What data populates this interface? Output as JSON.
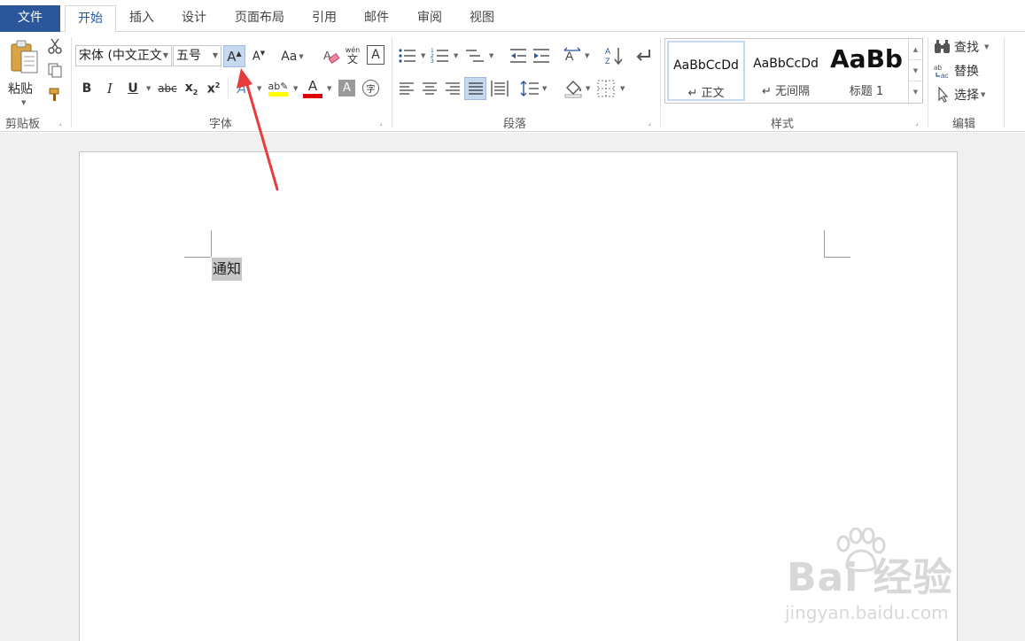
{
  "tabs": {
    "file": "文件",
    "home": "开始",
    "insert": "插入",
    "design": "设计",
    "layout": "页面布局",
    "references": "引用",
    "mailings": "邮件",
    "review": "审阅",
    "view": "视图"
  },
  "clipboard": {
    "paste_label": "粘贴",
    "group_label": "剪贴板"
  },
  "font": {
    "font_name": "宋体 (中文正文",
    "font_size": "五号",
    "change_case_label": "Aa",
    "phonetic_top": "wén",
    "phonetic_bottom": "文",
    "group_label": "字体",
    "highlight_color": "#ffff00",
    "font_color": "#e00000"
  },
  "paragraph": {
    "group_label": "段落"
  },
  "styles": {
    "items": [
      {
        "sample": "AaBbCcDd",
        "name": "↵ 正文"
      },
      {
        "sample": "AaBbCcDd",
        "name": "↵ 无间隔"
      },
      {
        "sample": "AaBb",
        "name": "标题 1"
      }
    ],
    "group_label": "样式"
  },
  "editing": {
    "find": "查找",
    "replace": "替换",
    "select": "选择",
    "group_label": "编辑"
  },
  "document": {
    "text": "通知"
  },
  "watermark": {
    "logo": "Bai 经验",
    "url": "jingyan.baidu.com"
  },
  "colors": {
    "file_tab": "#2b579a",
    "accent": "#2b579a",
    "arrow": "#e83b3b",
    "selection": "#c6c6c6"
  }
}
